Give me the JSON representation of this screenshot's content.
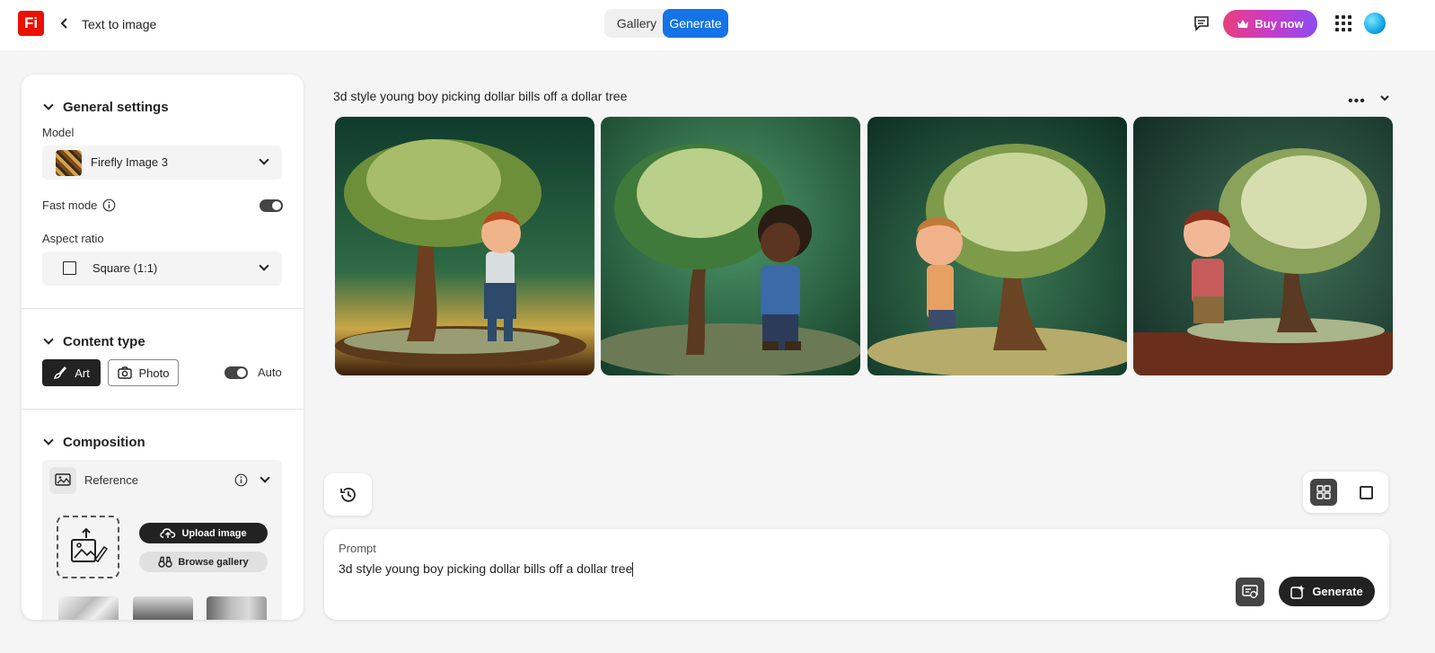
{
  "app": {
    "logo": "Fi",
    "back_label": "Text to image"
  },
  "header": {
    "tabs": [
      {
        "label": "Gallery"
      },
      {
        "label": "Generate",
        "active": true
      }
    ],
    "buy_label": "Buy now"
  },
  "settings": {
    "general_title": "General settings",
    "model_label": "Model",
    "model_value": "Firefly Image 3",
    "fast_mode_label": "Fast mode",
    "fast_mode_on": true,
    "aspect_label": "Aspect ratio",
    "aspect_value": "Square (1:1)",
    "content_title": "Content type",
    "art_label": "Art",
    "photo_label": "Photo",
    "auto_label": "Auto",
    "composition_title": "Composition",
    "reference_label": "Reference",
    "upload_label": "Upload image",
    "browse_label": "Browse gallery"
  },
  "results": {
    "prompt_title": "3d style young boy picking dollar bills off a dollar tree",
    "images": [
      {
        "icon": "money-tree-image-1"
      },
      {
        "icon": "money-tree-image-2"
      },
      {
        "icon": "money-tree-image-3"
      },
      {
        "icon": "money-tree-image-4"
      }
    ]
  },
  "prompt": {
    "label": "Prompt",
    "value": "3d style young boy picking dollar bills off a dollar tree",
    "generate_label": "Generate"
  },
  "colors": {
    "accent": "#1473e6",
    "brand": "#eb1000",
    "dark": "#222222"
  }
}
